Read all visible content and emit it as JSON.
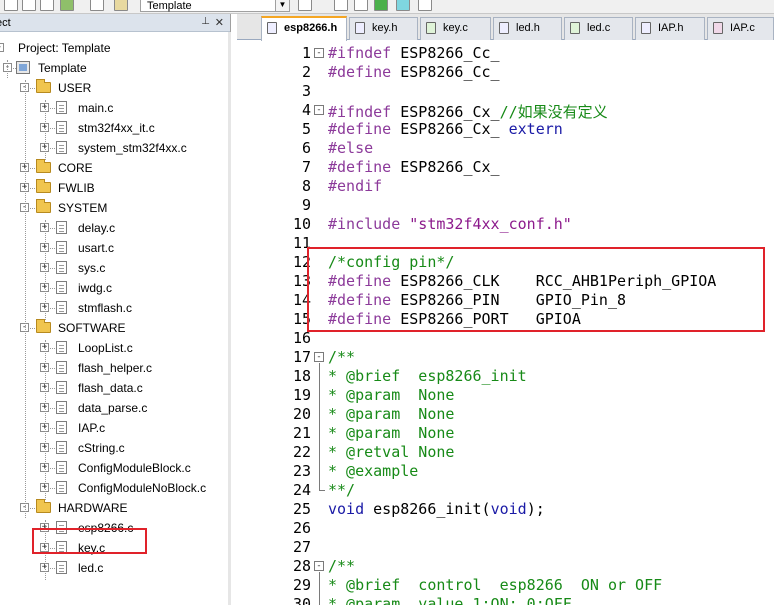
{
  "toolbar": {
    "target_name": "Template"
  },
  "project_panel": {
    "title": "ect",
    "pin_icon": "pin-icon",
    "close_icon": "close-icon"
  },
  "tree": [
    {
      "label": "Project: Template",
      "depth": 0,
      "kind": "project",
      "expander": "-"
    },
    {
      "label": "Template",
      "depth": 1,
      "kind": "target",
      "expander": "-"
    },
    {
      "label": "USER",
      "depth": 2,
      "kind": "folder",
      "expander": "-"
    },
    {
      "label": "main.c",
      "depth": 3,
      "kind": "file",
      "expander": "+"
    },
    {
      "label": "stm32f4xx_it.c",
      "depth": 3,
      "kind": "file",
      "expander": "+"
    },
    {
      "label": "system_stm32f4xx.c",
      "depth": 3,
      "kind": "file",
      "expander": "+"
    },
    {
      "label": "CORE",
      "depth": 2,
      "kind": "folder",
      "expander": "+"
    },
    {
      "label": "FWLIB",
      "depth": 2,
      "kind": "folder",
      "expander": "+"
    },
    {
      "label": "SYSTEM",
      "depth": 2,
      "kind": "folder",
      "expander": "-"
    },
    {
      "label": "delay.c",
      "depth": 3,
      "kind": "file",
      "expander": "+"
    },
    {
      "label": "usart.c",
      "depth": 3,
      "kind": "file",
      "expander": "+"
    },
    {
      "label": "sys.c",
      "depth": 3,
      "kind": "file",
      "expander": "+"
    },
    {
      "label": "iwdg.c",
      "depth": 3,
      "kind": "file",
      "expander": "+"
    },
    {
      "label": "stmflash.c",
      "depth": 3,
      "kind": "file",
      "expander": "+"
    },
    {
      "label": "SOFTWARE",
      "depth": 2,
      "kind": "folder",
      "expander": "-"
    },
    {
      "label": "LoopList.c",
      "depth": 3,
      "kind": "file",
      "expander": "+"
    },
    {
      "label": "flash_helper.c",
      "depth": 3,
      "kind": "file",
      "expander": "+"
    },
    {
      "label": "flash_data.c",
      "depth": 3,
      "kind": "file",
      "expander": "+"
    },
    {
      "label": "data_parse.c",
      "depth": 3,
      "kind": "file",
      "expander": "+"
    },
    {
      "label": "IAP.c",
      "depth": 3,
      "kind": "file",
      "expander": "+"
    },
    {
      "label": "cString.c",
      "depth": 3,
      "kind": "file",
      "expander": "+"
    },
    {
      "label": "ConfigModuleBlock.c",
      "depth": 3,
      "kind": "file",
      "expander": "+"
    },
    {
      "label": "ConfigModuleNoBlock.c",
      "depth": 3,
      "kind": "file",
      "expander": "+"
    },
    {
      "label": "HARDWARE",
      "depth": 2,
      "kind": "folder",
      "expander": "-"
    },
    {
      "label": "esp8266.c",
      "depth": 3,
      "kind": "file",
      "expander": "+",
      "selected": true
    },
    {
      "label": "key.c",
      "depth": 3,
      "kind": "file",
      "expander": "+"
    },
    {
      "label": "led.c",
      "depth": 3,
      "kind": "file",
      "expander": "+"
    }
  ],
  "tabs": [
    {
      "label": "esp8266.h",
      "type": "h",
      "active": true
    },
    {
      "label": "key.h",
      "type": "h"
    },
    {
      "label": "key.c",
      "type": "c"
    },
    {
      "label": "led.h",
      "type": "h"
    },
    {
      "label": "led.c",
      "type": "c"
    },
    {
      "label": "IAP.h",
      "type": "h"
    },
    {
      "label": "IAP.c",
      "type": "hi"
    }
  ],
  "code": [
    {
      "n": "1",
      "fold": "-",
      "tokens": [
        [
          "pre",
          "#ifndef "
        ],
        [
          "macro",
          "ESP8266_Cc_"
        ]
      ]
    },
    {
      "n": "2",
      "tokens": [
        [
          "pre",
          "#define "
        ],
        [
          "macro",
          "ESP8266_Cc_"
        ]
      ]
    },
    {
      "n": "3",
      "tokens": []
    },
    {
      "n": "4",
      "fold": "-",
      "tokens": [
        [
          "pre",
          "#ifndef "
        ],
        [
          "macro",
          "ESP8266_Cx_"
        ],
        [
          "cmt",
          "//如果没有定义"
        ]
      ]
    },
    {
      "n": "5",
      "tokens": [
        [
          "pre",
          "#define "
        ],
        [
          "macro",
          "ESP8266_Cx_ "
        ],
        [
          "kw",
          "extern"
        ]
      ]
    },
    {
      "n": "6",
      "tokens": [
        [
          "pre",
          "#else"
        ]
      ]
    },
    {
      "n": "7",
      "tokens": [
        [
          "pre",
          "#define "
        ],
        [
          "macro",
          "ESP8266_Cx_"
        ]
      ]
    },
    {
      "n": "8",
      "tokens": [
        [
          "pre",
          "#endif"
        ]
      ]
    },
    {
      "n": "9",
      "tokens": []
    },
    {
      "n": "10",
      "tokens": [
        [
          "pre",
          "#include "
        ],
        [
          "str",
          "\"stm32f4xx_conf.h\""
        ]
      ]
    },
    {
      "n": "11",
      "tokens": []
    },
    {
      "n": "12",
      "tokens": [
        [
          "cmt",
          "/*config pin*/"
        ]
      ]
    },
    {
      "n": "13",
      "tokens": [
        [
          "pre",
          "#define "
        ],
        [
          "macro",
          "ESP8266_CLK    RCC_AHB1Periph_GPIOA"
        ]
      ]
    },
    {
      "n": "14",
      "tokens": [
        [
          "pre",
          "#define "
        ],
        [
          "macro",
          "ESP8266_PIN    GPIO_Pin_8"
        ]
      ]
    },
    {
      "n": "15",
      "tokens": [
        [
          "pre",
          "#define "
        ],
        [
          "macro",
          "ESP8266_PORT   GPIOA"
        ]
      ]
    },
    {
      "n": "16",
      "tokens": []
    },
    {
      "n": "17",
      "fold": "-",
      "tokens": [
        [
          "cmt",
          "/**"
        ]
      ]
    },
    {
      "n": "18",
      "tokens": [
        [
          "cmt",
          "* @brief  esp8266_init"
        ]
      ]
    },
    {
      "n": "19",
      "tokens": [
        [
          "cmt",
          "* @param  None"
        ]
      ]
    },
    {
      "n": "20",
      "tokens": [
        [
          "cmt",
          "* @param  None"
        ]
      ]
    },
    {
      "n": "21",
      "tokens": [
        [
          "cmt",
          "* @param  None"
        ]
      ]
    },
    {
      "n": "22",
      "tokens": [
        [
          "cmt",
          "* @retval None"
        ]
      ]
    },
    {
      "n": "23",
      "tokens": [
        [
          "cmt",
          "* @example"
        ]
      ]
    },
    {
      "n": "24",
      "foldend": true,
      "tokens": [
        [
          "cmt",
          "**/"
        ]
      ]
    },
    {
      "n": "25",
      "tokens": [
        [
          "kw",
          "void "
        ],
        [
          "plain",
          "esp8266_init("
        ],
        [
          "kw",
          "void"
        ],
        [
          "plain",
          ");"
        ]
      ]
    },
    {
      "n": "26",
      "tokens": []
    },
    {
      "n": "27",
      "tokens": []
    },
    {
      "n": "28",
      "fold": "-",
      "tokens": [
        [
          "cmt",
          "/**"
        ]
      ]
    },
    {
      "n": "29",
      "tokens": [
        [
          "cmt",
          "* @brief  control  esp8266  ON or OFF"
        ]
      ]
    },
    {
      "n": "30",
      "tokens": [
        [
          "cmt",
          "* @param  value 1:ON; 0:OFF"
        ]
      ]
    }
  ]
}
